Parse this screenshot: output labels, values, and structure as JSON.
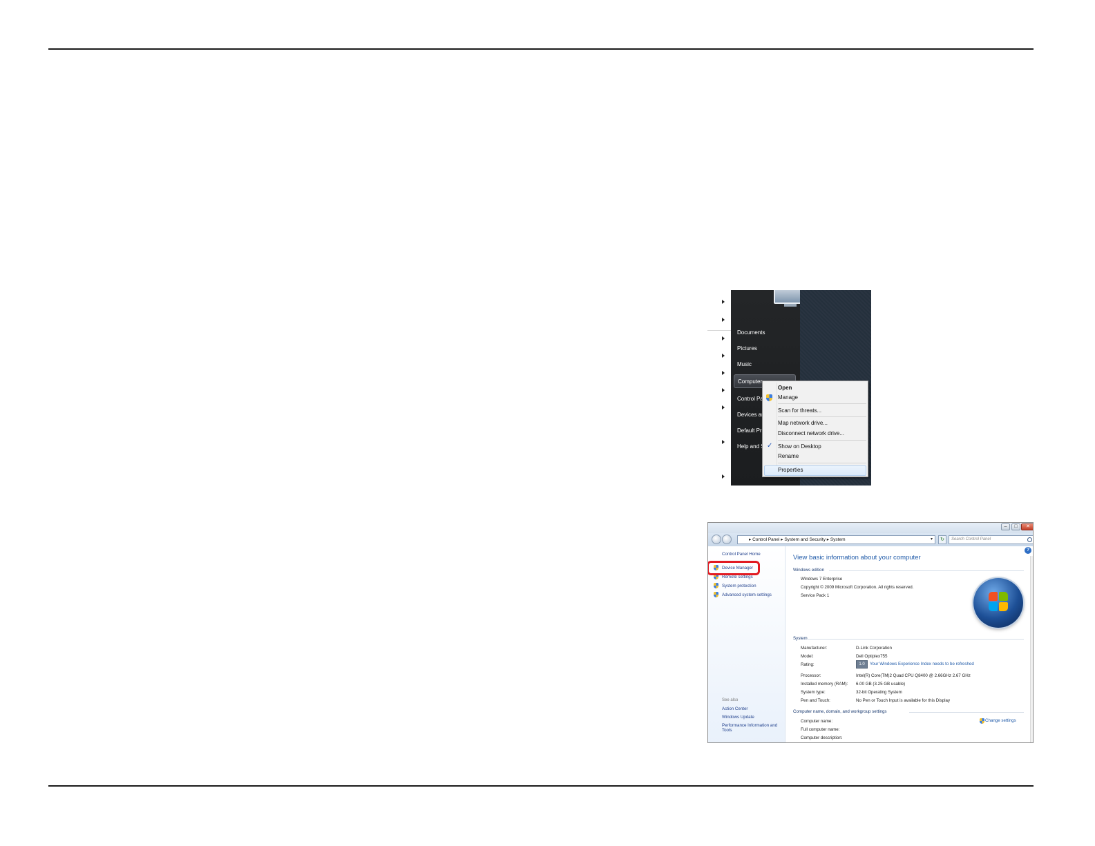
{
  "start_menu": {
    "items": [
      "Documents",
      "Pictures",
      "Music",
      "Computer",
      "Control Pa",
      "Devices an",
      "Default Pr",
      "Help and S"
    ],
    "selected_item": "Computer"
  },
  "context_menu": {
    "open": "Open",
    "manage": "Manage",
    "scan": "Scan for threats...",
    "map_drive": "Map network drive...",
    "disconnect_drive": "Disconnect network drive...",
    "show_on_desktop": "Show on Desktop",
    "rename": "Rename",
    "properties": "Properties",
    "show_on_desktop_checked": true
  },
  "system_window": {
    "breadcrumb": [
      "Control Panel",
      "System and Security",
      "System"
    ],
    "search_placeholder": "Search Control Panel",
    "sidebar": {
      "home": "Control Panel Home",
      "tasks": [
        "Device Manager",
        "Remote settings",
        "System protection",
        "Advanced system settings"
      ],
      "highlighted_task": "Device Manager",
      "see_also_label": "See also",
      "see_also": [
        "Action Center",
        "Windows Update",
        "Performance Information and",
        "Tools"
      ]
    },
    "title": "View basic information about your computer",
    "windows_edition": {
      "heading": "Windows edition",
      "edition": "Windows 7 Enterprise",
      "copyright": "Copyright © 2009 Microsoft Corporation.  All rights reserved.",
      "service_pack": "Service Pack 1"
    },
    "system": {
      "heading": "System",
      "manufacturer_label": "Manufacturer:",
      "manufacturer": "D-Link Corporation",
      "model_label": "Model:",
      "model": "Dell Optiplex755",
      "rating_label": "Rating:",
      "rating_badge": "1.0",
      "rating_link": "Your Windows Experience Index needs to be refreshed",
      "processor_label": "Processor:",
      "processor": "Intel(R) Core(TM)2 Quad CPU    Q8400  @ 2.66GHz   2.67 GHz",
      "ram_label": "Installed memory (RAM):",
      "ram": "6.00 GB (3.25 GB usable)",
      "type_label": "System type:",
      "type": "32-bit Operating System",
      "pen_label": "Pen and Touch:",
      "pen": "No Pen or Touch Input is available for this Display"
    },
    "computer_name": {
      "heading": "Computer name, domain, and workgroup settings",
      "name_label": "Computer name:",
      "full_name_label": "Full computer name:",
      "description_label": "Computer description:",
      "change_settings": "Change settings"
    }
  },
  "colors": {
    "highlight_box": "#e21b22",
    "link": "#1f5aa8",
    "start_menu_bg": "#1b1d1f"
  }
}
